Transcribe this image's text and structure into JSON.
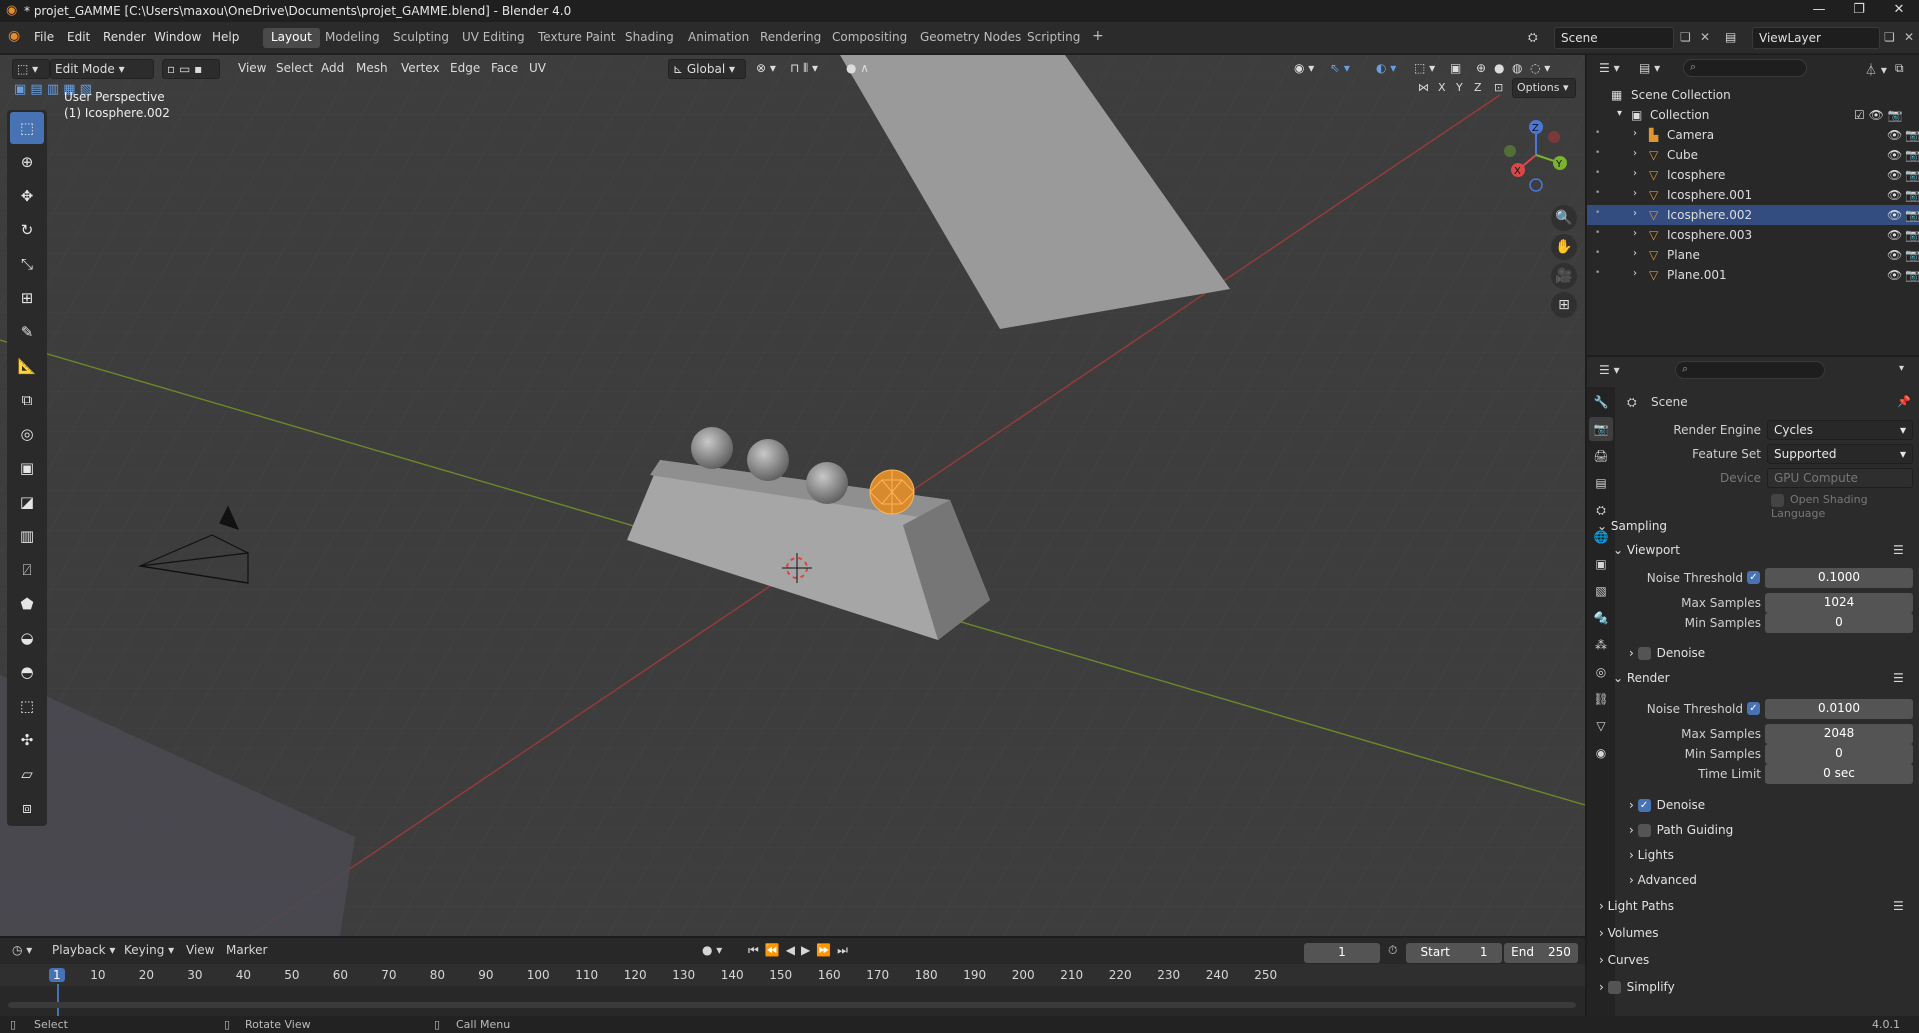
{
  "window": {
    "title": "* projet_GAMME [C:\\Users\\maxou\\OneDrive\\Documents\\projet_GAMME.blend] - Blender 4.0"
  },
  "menu": [
    "File",
    "Edit",
    "Render",
    "Window",
    "Help"
  ],
  "workspaces": [
    "Layout",
    "Modeling",
    "Sculpting",
    "UV Editing",
    "Texture Paint",
    "Shading",
    "Animation",
    "Rendering",
    "Compositing",
    "Geometry Nodes",
    "Scripting"
  ],
  "active_workspace": "Layout",
  "scene": {
    "name": "Scene",
    "view_layer": "ViewLayer"
  },
  "viewport": {
    "mode": "Edit Mode",
    "menus": [
      "View",
      "Select",
      "Add",
      "Mesh",
      "Vertex",
      "Edge",
      "Face",
      "UV"
    ],
    "transform": "Global",
    "options": "Options",
    "axes": [
      "X",
      "Y",
      "Z"
    ],
    "overlay_title": "User Perspective",
    "overlay_object": "(1) Icosphere.002",
    "gizmo": {
      "x": "X",
      "y": "Y",
      "z": "Z"
    }
  },
  "outliner": {
    "root": "Scene Collection",
    "collection": "Collection",
    "items": [
      {
        "name": "Camera",
        "selected": false
      },
      {
        "name": "Cube",
        "selected": false
      },
      {
        "name": "Icosphere",
        "selected": false
      },
      {
        "name": "Icosphere.001",
        "selected": false
      },
      {
        "name": "Icosphere.002",
        "selected": true
      },
      {
        "name": "Icosphere.003",
        "selected": false
      },
      {
        "name": "Plane",
        "selected": false
      },
      {
        "name": "Plane.001",
        "selected": false
      }
    ]
  },
  "properties": {
    "context": "Scene",
    "render_engine_label": "Render Engine",
    "render_engine": "Cycles",
    "feature_set_label": "Feature Set",
    "feature_set": "Supported",
    "device_label": "Device",
    "device": "GPU Compute",
    "osl_label": "Open Shading Language",
    "sampling": "Sampling",
    "viewport": "Viewport",
    "vp_noise_label": "Noise Threshold",
    "vp_noise": "0.1000",
    "vp_max_label": "Max Samples",
    "vp_max": "1024",
    "vp_min_label": "Min Samples",
    "vp_min": "0",
    "vp_denoise": "Denoise",
    "render": "Render",
    "r_noise_label": "Noise Threshold",
    "r_noise": "0.0100",
    "r_max_label": "Max Samples",
    "r_max": "2048",
    "r_min_label": "Min Samples",
    "r_min": "0",
    "r_time_label": "Time Limit",
    "r_time": "0 sec",
    "r_denoise": "Denoise",
    "path_guiding": "Path Guiding",
    "lights": "Lights",
    "advanced": "Advanced",
    "light_paths": "Light Paths",
    "volumes": "Volumes",
    "curves": "Curves",
    "simplify": "Simplify"
  },
  "timeline": {
    "menus": [
      "Playback",
      "Keying",
      "View",
      "Marker"
    ],
    "current": "1",
    "start_label": "Start",
    "start": "1",
    "end_label": "End",
    "end": "250",
    "ticks": [
      "1",
      "10",
      "20",
      "30",
      "40",
      "50",
      "60",
      "70",
      "80",
      "90",
      "100",
      "110",
      "120",
      "130",
      "140",
      "150",
      "160",
      "170",
      "180",
      "190",
      "200",
      "210",
      "220",
      "230",
      "240",
      "250"
    ]
  },
  "status": {
    "select": "Select",
    "rotate": "Rotate View",
    "menu": "Call Menu",
    "version": "4.0.1"
  }
}
